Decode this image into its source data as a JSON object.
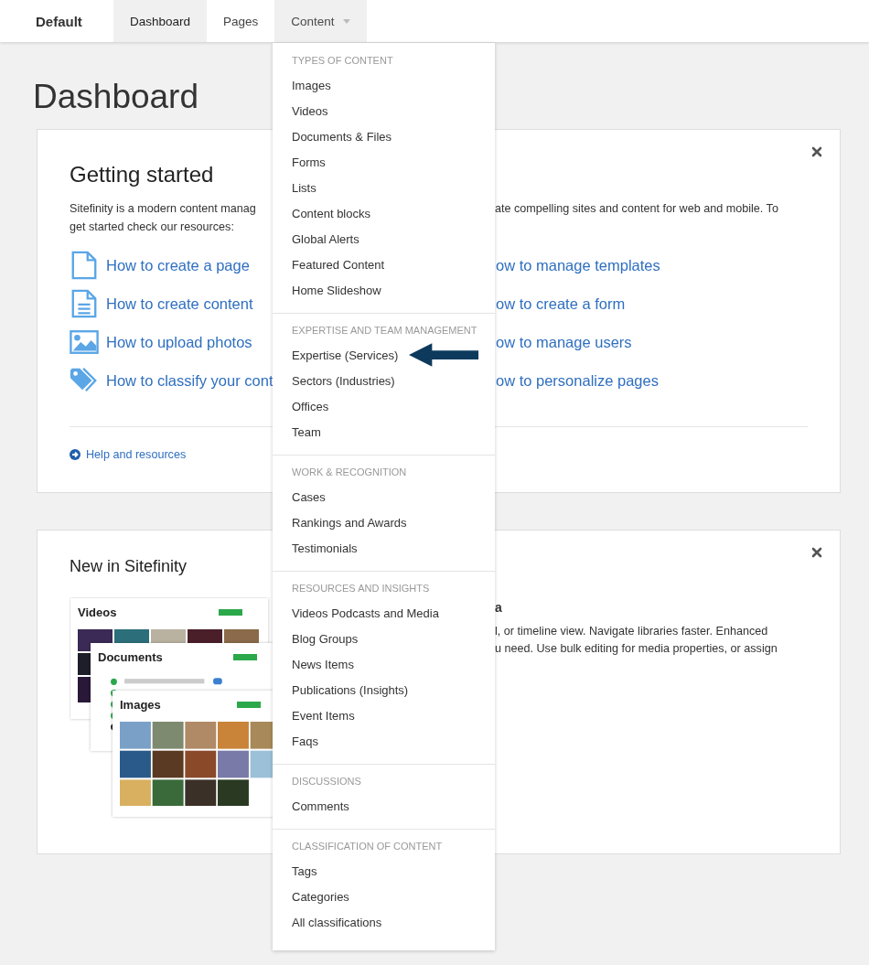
{
  "site": {
    "name": "Default"
  },
  "tabs": [
    {
      "label": "Dashboard",
      "selected": true,
      "has_menu": false
    },
    {
      "label": "Pages",
      "selected": false,
      "has_menu": false
    },
    {
      "label": "Content",
      "selected": false,
      "has_menu": true
    }
  ],
  "page_title": "Dashboard",
  "getting_started": {
    "title": "Getting started",
    "intro_left_lines": [
      "Sitefinity is a modern content manag",
      "get started check our resources:"
    ],
    "intro_right_lines": [
      "ate compelling sites and content for web and mobile. To"
    ],
    "links_left": [
      "How to create a page",
      "How to create content",
      "How to upload photos",
      "How to classify your cont"
    ],
    "links_right": [
      "ow to manage templates",
      "ow to create a form",
      "ow to manage users",
      "ow to personalize pages"
    ],
    "help_link": "Help and resources"
  },
  "new_in": {
    "title": "New in Sitefinity",
    "preview": [
      {
        "title": "Videos",
        "kind": "videos"
      },
      {
        "title": "Documents",
        "kind": "documents"
      },
      {
        "title": "Images",
        "kind": "images"
      }
    ],
    "heading_end": "a",
    "text_lines": [
      "l, or timeline view. Navigate libraries faster. Enhanced",
      "u need. Use bulk editing for media properties, or assign"
    ]
  },
  "content_menu": {
    "expanded": true,
    "sections": [
      {
        "header": "TYPES OF CONTENT",
        "items": [
          {
            "label": "Images",
            "arrow": false
          },
          {
            "label": "Videos",
            "arrow": false
          },
          {
            "label": "Documents & Files",
            "arrow": false
          },
          {
            "label": "Forms",
            "arrow": false
          },
          {
            "label": "Lists",
            "arrow": false
          },
          {
            "label": "Content blocks",
            "arrow": false
          },
          {
            "label": "Global Alerts",
            "arrow": false
          },
          {
            "label": "Featured Content",
            "arrow": false
          },
          {
            "label": "Home Slideshow",
            "arrow": false
          }
        ]
      },
      {
        "header": "EXPERTISE AND TEAM MANAGEMENT",
        "items": [
          {
            "label": "Expertise (Services)",
            "arrow": true
          },
          {
            "label": "Sectors (Industries)",
            "arrow": false
          },
          {
            "label": "Offices",
            "arrow": false
          },
          {
            "label": "Team",
            "arrow": false
          }
        ]
      },
      {
        "header": "WORK & RECOGNITION",
        "items": [
          {
            "label": "Cases",
            "arrow": false
          },
          {
            "label": "Rankings and Awards",
            "arrow": false
          },
          {
            "label": "Testimonials",
            "arrow": false
          }
        ]
      },
      {
        "header": "RESOURCES AND INSIGHTS",
        "items": [
          {
            "label": "Videos Podcasts and Media",
            "arrow": false
          },
          {
            "label": "Blog Groups",
            "arrow": false
          },
          {
            "label": "News Items",
            "arrow": false
          },
          {
            "label": "Publications (Insights)",
            "arrow": false
          },
          {
            "label": "Event Items",
            "arrow": false
          },
          {
            "label": "Faqs",
            "arrow": false
          }
        ]
      },
      {
        "header": "DISCUSSIONS",
        "items": [
          {
            "label": "Comments",
            "arrow": false
          }
        ]
      },
      {
        "header": "CLASSIFICATION OF CONTENT",
        "items": [
          {
            "label": "Tags",
            "arrow": false
          },
          {
            "label": "Categories",
            "arrow": false
          },
          {
            "label": "All classifications",
            "arrow": false
          }
        ]
      }
    ]
  }
}
